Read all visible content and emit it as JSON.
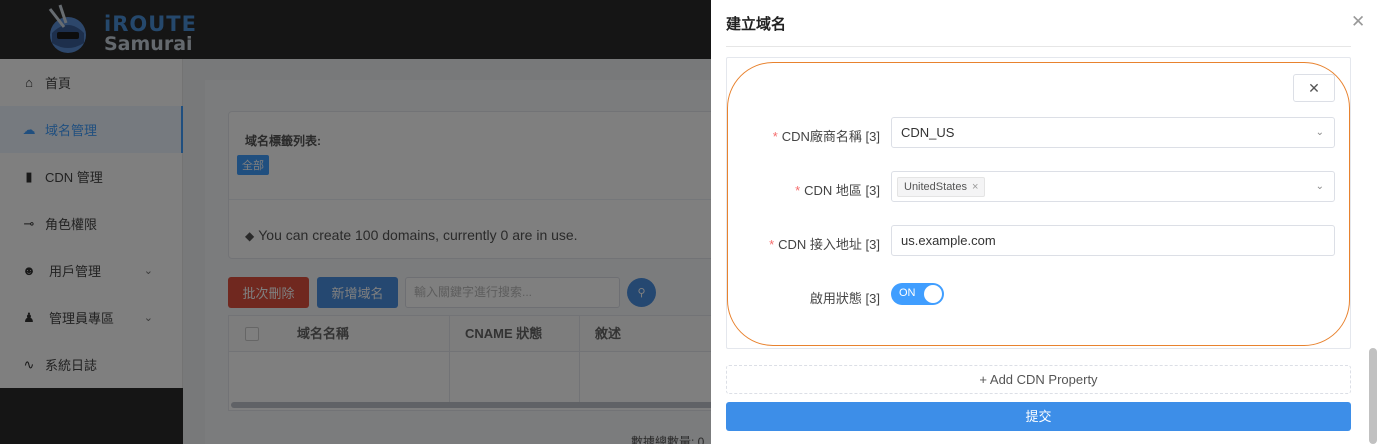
{
  "app": {
    "logo_line1": "iROUTE",
    "logo_line2": "Samurai"
  },
  "sidebar": {
    "items": [
      {
        "label": "首頁",
        "icon": "home-icon"
      },
      {
        "label": "域名管理",
        "icon": "cloud-icon"
      },
      {
        "label": "CDN 管理",
        "icon": "file-icon"
      },
      {
        "label": "角色權限",
        "icon": "key-icon"
      },
      {
        "label": "用戶管理",
        "icon": "user-icon"
      },
      {
        "label": "管理員專區",
        "icon": "admin-icon"
      },
      {
        "label": "系統日誌",
        "icon": "activity-icon"
      }
    ]
  },
  "main": {
    "tag_title": "域名標籤列表:",
    "tag_all": "全部",
    "note": "You can create 100 domains, currently 0 are in use.",
    "btn_batch_delete": "批次刪除",
    "btn_add_domain": "新增域名",
    "search_placeholder": "輸入關鍵字進行搜索...",
    "columns": [
      "域名名稱",
      "CNAME 狀態",
      "敘述"
    ],
    "count_label": "數據總數量: 0"
  },
  "drawer": {
    "title": "建立域名",
    "fields": {
      "vendor": {
        "label": "CDN廠商名稱 [3]",
        "value": "CDN_US"
      },
      "region": {
        "label": "CDN 地區 [3]",
        "tag": "UnitedStates"
      },
      "endpoint": {
        "label": "CDN 接入地址 [3]",
        "value": "us.example.com"
      },
      "enabled": {
        "label": "啟用狀態 [3]",
        "switch_text": "ON",
        "on": true
      }
    },
    "add_property": "+ Add CDN Property",
    "submit": "提交"
  },
  "colors": {
    "accent": "#409eff",
    "danger": "#e0503f",
    "highlight": "#e8822e",
    "topbar": "#2b2b2b"
  }
}
